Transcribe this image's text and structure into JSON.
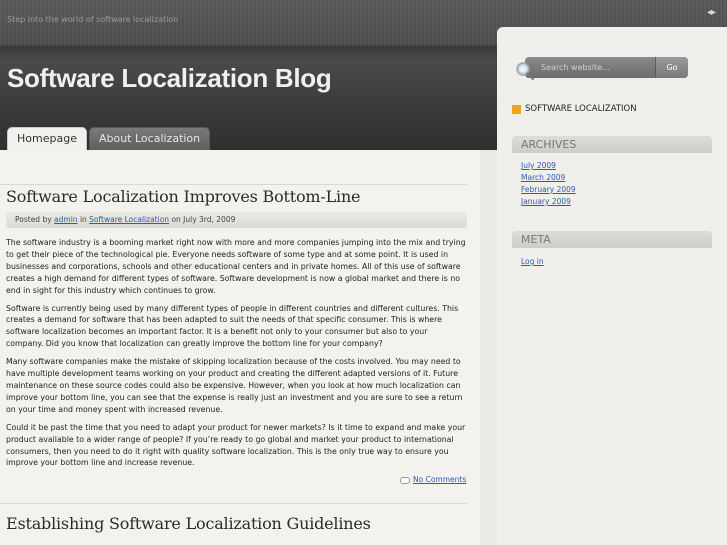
{
  "header": {
    "tagline": "Step into the world of software localization",
    "arrows": "◂▸",
    "title": "Software Localization Blog"
  },
  "nav": {
    "tabs": [
      {
        "label": "Homepage",
        "active": true
      },
      {
        "label": "About Localization",
        "active": false
      }
    ]
  },
  "posts": [
    {
      "title": "Software Localization Improves Bottom-Line",
      "meta": {
        "prefix": "Posted by",
        "author": "admin",
        "in_word": "in",
        "category": "Software Localization",
        "date_text": "on July 3rd, 2009"
      },
      "paragraphs": [
        "The software industry is a booming market right now with more and more companies jumping into the mix and trying to get their piece of the technological pie. Everyone needs software of some type and at some point. It is used in businesses and corporations, schools and other educational centers and in private homes. All of this use of software creates a high demand for different types of software. Software development is now a global market and there is no end in sight for this industry which continues to grow.",
        "Software is currently being used by many different types of people in different countries and different cultures. This creates a demand for software that has been adapted to suit the needs of that specific consumer. This is where software localization becomes an important factor. It is a benefit not only to your consumer but also to your company. Did you know that localization can greatly improve the bottom line for your company?",
        "Many software companies make the mistake of skipping localization because of the costs involved. You may need to have multiple development teams working on your product and creating the different adapted versions of it. Future maintenance on these source codes could also be expensive. However, when you look at how much localization can improve your bottom line, you can see that the expense is really just an investment and you are sure to see a return on your time and money spent with increased revenue.",
        "Could it be past the time that you need to adapt your product for newer markets? Is it time to expand and make your product available to a wider range of people? If you’re ready to go global and market your product to international consumers, then you need to do it right with quality software localization. This is the only true way to ensure you improve your bottom line and increase revenue."
      ],
      "comments": "No Comments"
    },
    {
      "title": "Establishing Software Localization Guidelines"
    }
  ],
  "sidebar": {
    "search": {
      "placeholder": "Search website...",
      "button": "Go"
    },
    "category": "SOFTWARE LOCALIZATION",
    "archives": {
      "title": "ARCHIVES",
      "items": [
        "July 2009",
        "March 2009",
        "February 2009",
        "January 2009"
      ]
    },
    "meta": {
      "title": "META",
      "items": [
        "Log in"
      ]
    }
  },
  "colors": {
    "accent": "#f0a31c",
    "link": "#2a5db0",
    "header": "#3d3d3d"
  }
}
